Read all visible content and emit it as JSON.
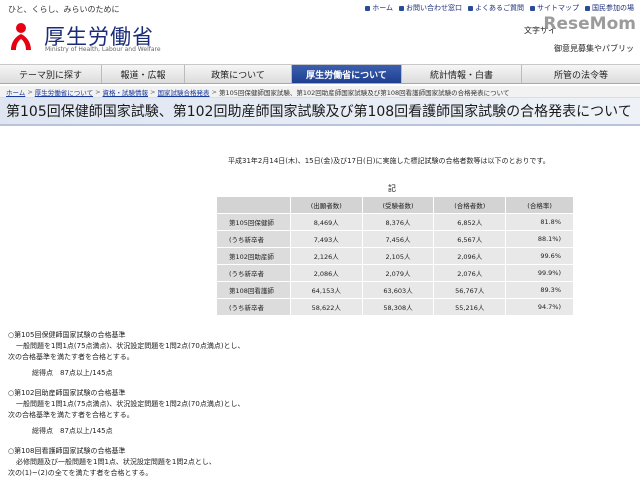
{
  "header": {
    "tagline": "ひと、くらし、みらいのために",
    "logo_jp": "厚生労働省",
    "logo_en": "Ministry of Health, Labour and Welfare",
    "util_links": [
      "ホーム",
      "お問い合わせ窓口",
      "よくあるご質問",
      "サイトマップ",
      "国民参加の場"
    ],
    "textsize_label": "文字サイ",
    "watermark": "ReseMom",
    "opinion_link": "御意見募集やパブリッ"
  },
  "nav": {
    "items": [
      "テーマ別に探す",
      "報道・広報",
      "政策について",
      "厚生労働省について",
      "統計情報・白書",
      "所管の法令等"
    ],
    "active_index": 3,
    "active_color": "#2a4a9a"
  },
  "breadcrumb": {
    "items": [
      "ホーム",
      "厚生労働省について",
      "資格・試験情報",
      "国家試験合格発表"
    ],
    "current": "第105回保健師国家試験、第102回助産師国家試験及び第108回看護師国家試験の合格発表について"
  },
  "page": {
    "title": "第105回保健師国家試験、第102回助産師国家試験及び第108回看護師国家試験の合格発表について",
    "intro": "平成31年2月14日(木)、15日(金)及び17日(日)に実施した標記試験の合格者数等は以下のとおりです。",
    "ki": "記"
  },
  "table": {
    "headers": [
      "",
      "(出願者数)",
      "(受験者数)",
      "(合格者数)",
      "(合格率)"
    ],
    "rows": [
      {
        "label": "第105回保健師",
        "c1": "8,469人",
        "c2": "8,376人",
        "c3": "6,852人",
        "c4": "81.8%"
      },
      {
        "label": "(うち新卒者",
        "c1": "7,493人",
        "c2": "7,456人",
        "c3": "6,567人",
        "c4": "88.1%)"
      },
      {
        "label": "第102回助産師",
        "c1": "2,126人",
        "c2": "2,105人",
        "c3": "2,096人",
        "c4": "99.6%"
      },
      {
        "label": "(うち新卒者",
        "c1": "2,086人",
        "c2": "2,079人",
        "c3": "2,076人",
        "c4": "99.9%)"
      },
      {
        "label": "第108回看護師",
        "c1": "64,153人",
        "c2": "63,603人",
        "c3": "56,767人",
        "c4": "89.3%"
      },
      {
        "label": "(うち新卒者",
        "c1": "58,622人",
        "c2": "58,308人",
        "c3": "55,216人",
        "c4": "94.7%)"
      }
    ]
  },
  "criteria": [
    {
      "heading": "○第105回保健師国家試験の合格基準",
      "line1": "一般問題を1問1点(75点満点)、状況設定問題を1問2点(70点満点)とし、",
      "line2": "次の合格基準を満たす者を合格とする。",
      "score": "総得点　87点以上/145点"
    },
    {
      "heading": "○第102回助産師国家試験の合格基準",
      "line1": "一般問題を1問1点(75点満点)、状況設定問題を1問2点(70点満点)とし、",
      "line2": "次の合格基準を満たす者を合格とする。",
      "score": "総得点　87点以上/145点"
    },
    {
      "heading": "○第108回看護師国家試験の合格基準",
      "line1": "必修問題及び一般問題を1問1点、状況設定問題を1問2点とし、",
      "line2": "次の(1)~(2)の全てを満たす者を合格とする。",
      "score": ""
    }
  ]
}
